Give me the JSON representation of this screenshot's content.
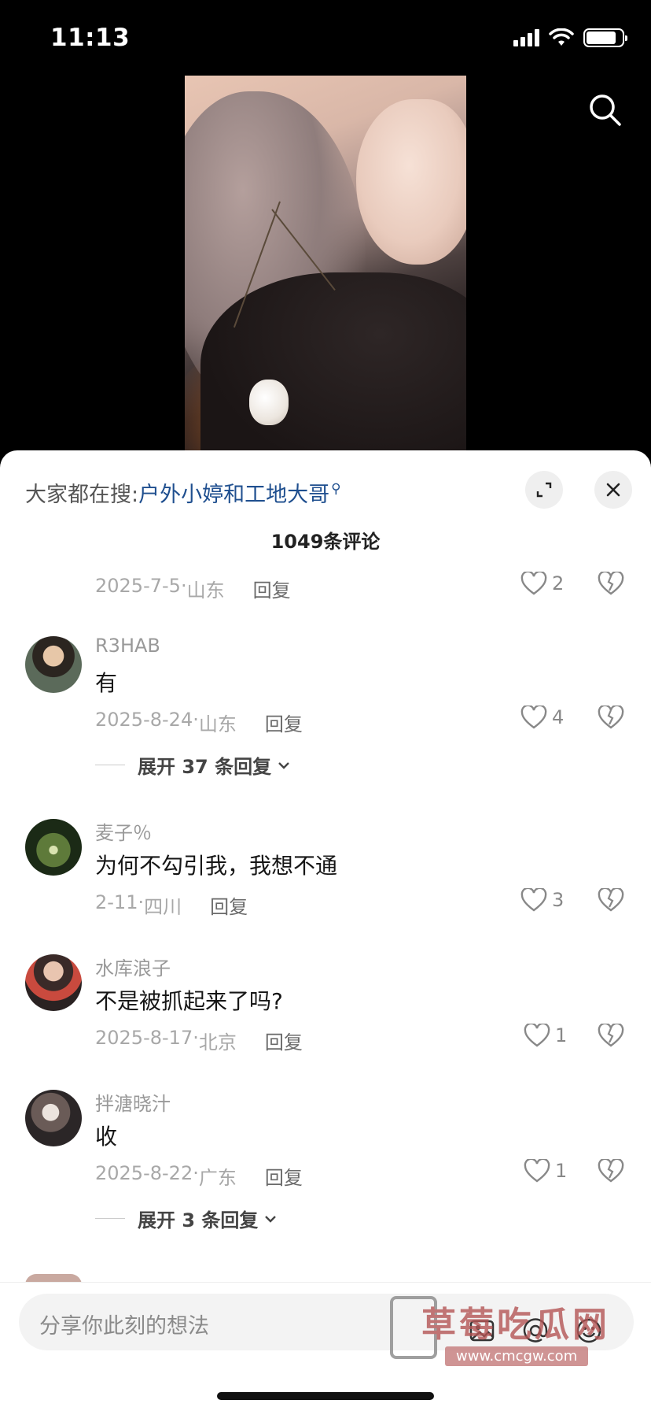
{
  "status_bar": {
    "time": "11:13",
    "battery_level": 0.85
  },
  "trending": {
    "prefix": "大家都在搜:",
    "topic": "户外小婷和工地大哥"
  },
  "comments_header": {
    "count_label": "1049条评论"
  },
  "comments": [
    {
      "date": "2025-7-5",
      "location": "山东",
      "reply_label": "回复",
      "likes": "2"
    },
    {
      "username": "R3HAB",
      "text": "有",
      "date": "2025-8-24",
      "location": "山东",
      "reply_label": "回复",
      "likes": "4",
      "expand_label": "展开 37 条回复"
    },
    {
      "username": "麦子％",
      "text": "为何不勾引我，我想不通",
      "date": "2-11",
      "location": "四川",
      "reply_label": "回复",
      "likes": "3"
    },
    {
      "username": "水库浪子",
      "text": "不是被抓起来了吗?",
      "date": "2025-8-17",
      "location": "北京",
      "reply_label": "回复",
      "likes": "1"
    },
    {
      "username": "拌溏晓汁",
      "text": "收",
      "date": "2025-8-22",
      "location": "广东",
      "reply_label": "回复",
      "likes": "1",
      "expand_label": "展开 3 条回复"
    }
  ],
  "input": {
    "placeholder": "分享你此刻的想法"
  },
  "watermark": {
    "title": "草莓吃瓜网",
    "url": "www.cmcgw.com"
  },
  "icons": [
    "search-icon",
    "expand-icon",
    "close-icon",
    "heart-icon",
    "dislike-heart-icon",
    "emoji-icon",
    "at-icon",
    "image-icon"
  ],
  "colors": {
    "link": "#1f4f8f",
    "sheet_bg": "#ffffff",
    "background": "#000000"
  }
}
